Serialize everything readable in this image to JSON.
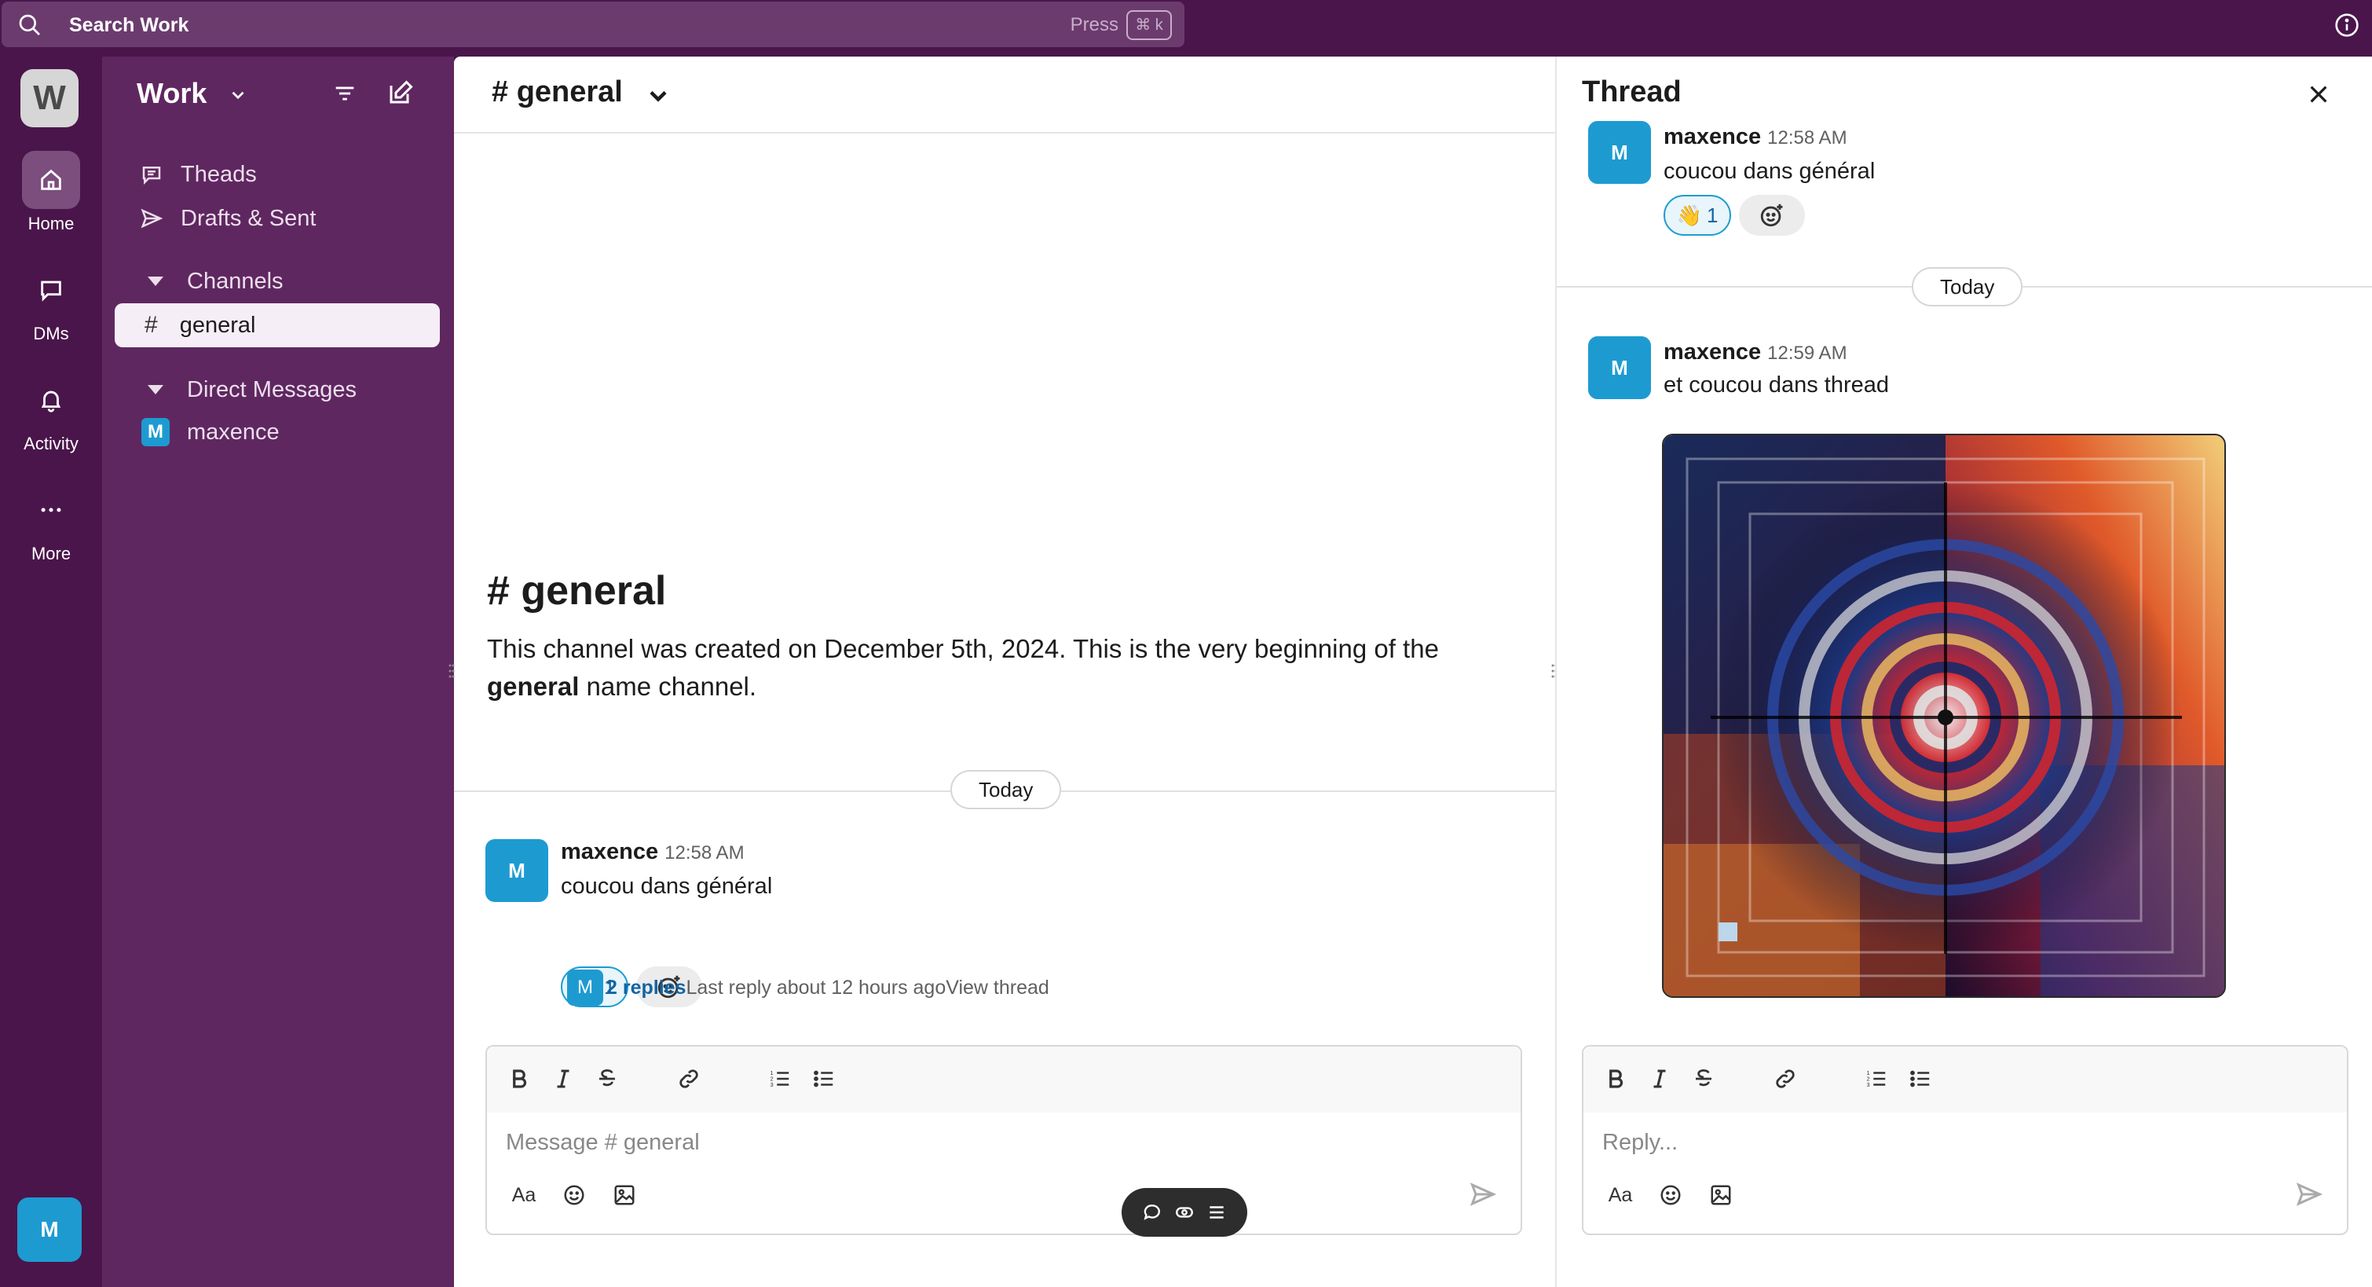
{
  "topbar": {
    "search_label": "Search Work",
    "press_label": "Press",
    "shortcut_label": "⌘ k"
  },
  "rail": {
    "workspace_initial": "W",
    "items": [
      {
        "label": "Home",
        "icon": "home-icon"
      },
      {
        "label": "DMs",
        "icon": "dms-icon"
      },
      {
        "label": "Activity",
        "icon": "bell-icon"
      },
      {
        "label": "More",
        "icon": "more-icon"
      }
    ],
    "user_initial": "M"
  },
  "sidebar": {
    "workspace_name": "Work",
    "nav": [
      {
        "label": "Theads",
        "icon": "threads-icon"
      },
      {
        "label": "Drafts & Sent",
        "icon": "send-icon"
      }
    ],
    "channels_section": "Channels",
    "channels": [
      {
        "label": "general",
        "active": true
      }
    ],
    "dm_section": "Direct Messages",
    "dms": [
      {
        "label": "maxence",
        "initial": "M"
      }
    ]
  },
  "main": {
    "header_title": "# general",
    "intro_title": "# general",
    "intro_text_1": "This channel was created on December 5th, 2024. This is the very beginning of the",
    "intro_bold": "general",
    "intro_text_2": " name channel.",
    "day_label": "Today",
    "message": {
      "avatar": "M",
      "author": "maxence",
      "time": "12:58 AM",
      "text": "coucou dans général",
      "reaction_emoji": "👋",
      "reaction_count": "1"
    },
    "replies": {
      "avatar": "M",
      "count": "2 replies",
      "last": "Last reply about 12 hours ago",
      "view": "View thread"
    },
    "composer_placeholder": "Message # general",
    "composer_aa": "Aa"
  },
  "thread": {
    "title": "Thread",
    "parent": {
      "avatar": "M",
      "author": "maxence",
      "time": "12:58 AM",
      "text": "coucou dans général",
      "reaction_emoji": "👋",
      "reaction_count": "1"
    },
    "day_label": "Today",
    "reply": {
      "avatar": "M",
      "author": "maxence",
      "time": "12:59 AM",
      "text": "et coucou dans thread"
    },
    "composer_placeholder": "Reply...",
    "composer_aa": "Aa"
  },
  "colors": {
    "brand": "#4a154b",
    "sidebar": "#5f2760",
    "accent": "#1d9bd1",
    "link": "#1264a3"
  }
}
